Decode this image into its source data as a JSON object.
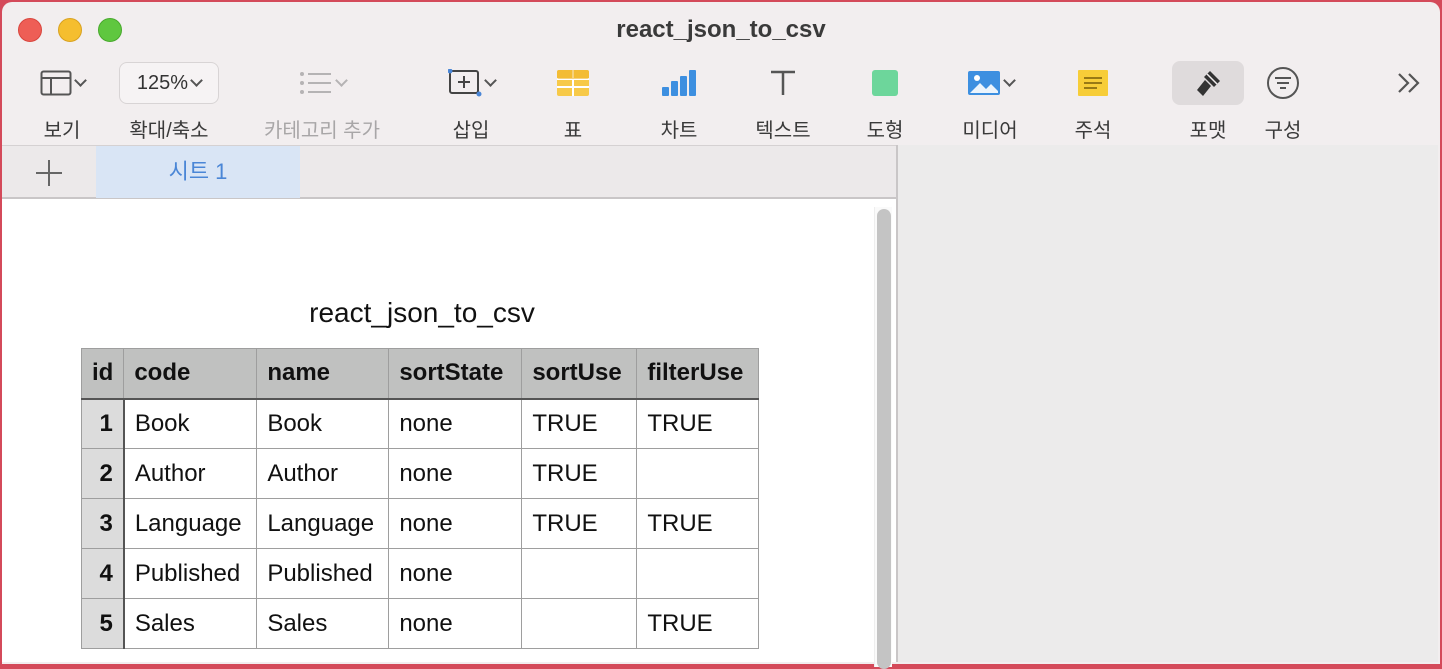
{
  "window": {
    "title": "react_json_to_csv"
  },
  "toolbar": {
    "view_label": "보기",
    "zoom_value": "125%",
    "zoom_label": "확대/축소",
    "add_category_label": "카테고리 추가",
    "insert_label": "삽입",
    "table_label": "표",
    "chart_label": "차트",
    "text_label": "텍스트",
    "shape_label": "도형",
    "media_label": "미디어",
    "comment_label": "주석",
    "format_label": "포맷",
    "organize_label": "구성"
  },
  "sheets": {
    "tabs": [
      {
        "label": "시트 1",
        "active": true
      }
    ]
  },
  "table": {
    "title": "react_json_to_csv",
    "columns": [
      "id",
      "code",
      "name",
      "sortState",
      "sortUse",
      "filterUse"
    ],
    "rows": [
      [
        "1",
        "Book",
        "Book",
        "none",
        "TRUE",
        "TRUE"
      ],
      [
        "2",
        "Author",
        "Author",
        "none",
        "TRUE",
        ""
      ],
      [
        "3",
        "Language",
        "Language",
        "none",
        "TRUE",
        "TRUE"
      ],
      [
        "4",
        "Published",
        "Published",
        "none",
        "",
        ""
      ],
      [
        "5",
        "Sales",
        "Sales",
        "none",
        "",
        "TRUE"
      ]
    ]
  },
  "colors": {
    "accent": "#4a86d6",
    "active_tab_bg": "#d9e5f5",
    "header_bg": "#c0c1c0",
    "id_col_bg": "#dcdcdc"
  }
}
